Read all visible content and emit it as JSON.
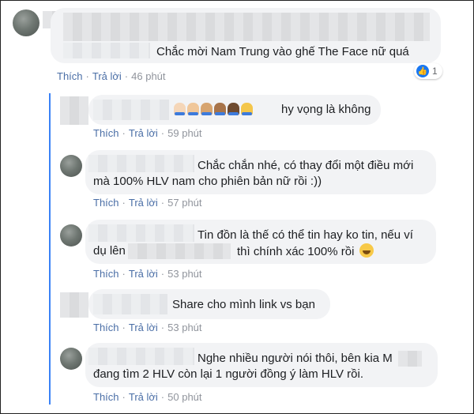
{
  "colors": {
    "link": "#4a6ea6",
    "meta": "#90949c",
    "bubble": "#f2f3f5",
    "thread_line": "#3b82f6",
    "like": "#1877f2"
  },
  "actions": {
    "like": "Thích",
    "reply": "Trả lời",
    "separator": "·"
  },
  "top_comment": {
    "text": "Chắc mời Nam Trung vào ghế The Face nữ quá",
    "time": "46 phút",
    "reaction_icon": "like-icon",
    "reaction_count": "1"
  },
  "replies": [
    {
      "text": "hy vọng là không",
      "time": "59 phút",
      "icons": [
        "folded-hands-icon",
        "folded-hands-icon",
        "folded-hands-icon",
        "folded-hands-icon",
        "folded-hands-icon",
        "folded-hands-icon"
      ]
    },
    {
      "line1": "Chắc chắn nhé, có thay đổi một điều mới",
      "line2": "mà 100% HLV nam cho phiên bản nữ rồi :))",
      "time": "57 phút"
    },
    {
      "line1": "Tin đồn là thế có thể tin hay ko tin, nếu ví",
      "line2_start": "dụ lên",
      "line2_end": "thì chính xác 100% rồi",
      "emoji": "grinning-sweat-emoji",
      "time": "53 phút"
    },
    {
      "text": "Share cho mình link vs bạn",
      "time": "53 phút"
    },
    {
      "line1": "Nghe nhiều người nói thôi, bên kia M",
      "line2": "đang tìm 2 HLV còn lại 1 người đồng ý làm HLV rồi.",
      "time": "50 phút"
    }
  ]
}
